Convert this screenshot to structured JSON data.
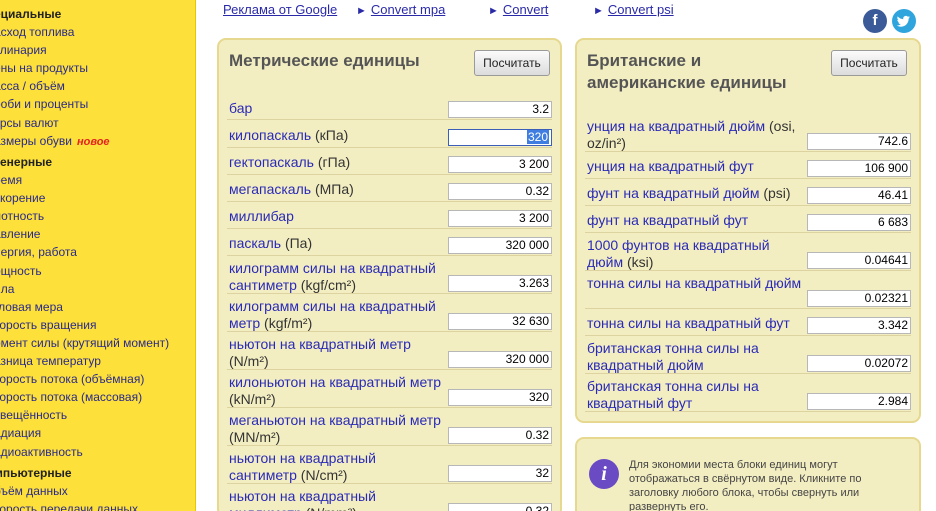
{
  "sidebar": {
    "section1": "ециальные",
    "links1": [
      "асход топлива",
      "улинария",
      "ены на продукты",
      "асса / объём",
      "роби и проценты",
      "урсы валют",
      "азмеры обуви"
    ],
    "new_badge": "новое",
    "section2": "кенерные",
    "links2": [
      "ремя",
      "скорение",
      "лотность",
      "авление",
      "нергия, работа",
      "ощность",
      "ила",
      "гловая мера",
      "корость вращения",
      "омент силы (крутящий момент)",
      "азница температур",
      "корость потока (объёмная)",
      "корость потока (массовая)",
      "свещённость",
      "адиация",
      "адиоактивность"
    ],
    "section3": "мпьютерные",
    "links3": [
      "бъём данных",
      "корость передачи данных"
    ]
  },
  "top": {
    "ads_label": "Реклама от Google",
    "link1": "Convert mpa",
    "link2": "Convert",
    "link3": "Convert psi",
    "arrow": "►",
    "facebook": "f"
  },
  "metric": {
    "title": "Метрические единицы",
    "button": "Посчитать",
    "rows": [
      {
        "name": "бар",
        "unit": "",
        "value": "3.2"
      },
      {
        "name": "килопаскаль",
        "unit": "(кПа)",
        "value": "320"
      },
      {
        "name": "гектопаскаль",
        "unit": "(гПа)",
        "value": "3 200"
      },
      {
        "name": "мегапаскаль",
        "unit": "(МПа)",
        "value": "0.32"
      },
      {
        "name": "миллибар",
        "unit": "",
        "value": "3 200"
      },
      {
        "name": "паскаль",
        "unit": "(Па)",
        "value": "320 000"
      },
      {
        "name": "килограмм силы на квадратный сантиметр",
        "unit": "(kgf/cm²)",
        "value": "3.263"
      },
      {
        "name": "килограмм силы на квадратный метр",
        "unit": "(kgf/m²)",
        "value": "32 630"
      },
      {
        "name": "ньютон на квадратный метр",
        "unit": "(N/m²)",
        "value": "320 000"
      },
      {
        "name": "килоньютон на квадратный метр",
        "unit": "(kN/m²)",
        "value": "320"
      },
      {
        "name": "меганьютон на квадратный метр",
        "unit": "(MN/m²)",
        "value": "0.32"
      },
      {
        "name": "ньютон на квадратный сантиметр",
        "unit": "(N/cm²)",
        "value": "32"
      },
      {
        "name": "ньютон на квадратный миллиметр",
        "unit": "(N/mm²)",
        "value": "0.32"
      }
    ]
  },
  "british": {
    "title": "Британские и\nамериканские единицы",
    "button": "Посчитать",
    "rows": [
      {
        "name": "унция на квадратный дюйм",
        "unit": "(osi, oz/in²)",
        "value": "742.6"
      },
      {
        "name": "унция на квадратный фут",
        "unit": "",
        "value": "106 900"
      },
      {
        "name": "фунт на квадратный дюйм",
        "unit": "(psi)",
        "value": "46.41"
      },
      {
        "name": "фунт на квадратный фут",
        "unit": "",
        "value": "6 683"
      },
      {
        "name": "1000 фунтов на квадратный дюйм",
        "unit": "(ksi)",
        "value": "0.04641"
      },
      {
        "name": "тонна силы на квадратный дюйм",
        "unit": "",
        "value": "0.02321"
      },
      {
        "name": "тонна силы на квадратный фут",
        "unit": "",
        "value": "3.342"
      },
      {
        "name": "британская тонна силы на квадратный дюйм",
        "unit": "",
        "value": "0.02072"
      },
      {
        "name": "британская тонна силы на квадратный фут",
        "unit": "",
        "value": "2.984"
      }
    ]
  },
  "info": {
    "icon": "i",
    "text": "Для экономии места блоки единиц могут отображаться в свёрнутом виде. Кликните по заголовку любого блока, чтобы свернуть или развернуть его."
  }
}
